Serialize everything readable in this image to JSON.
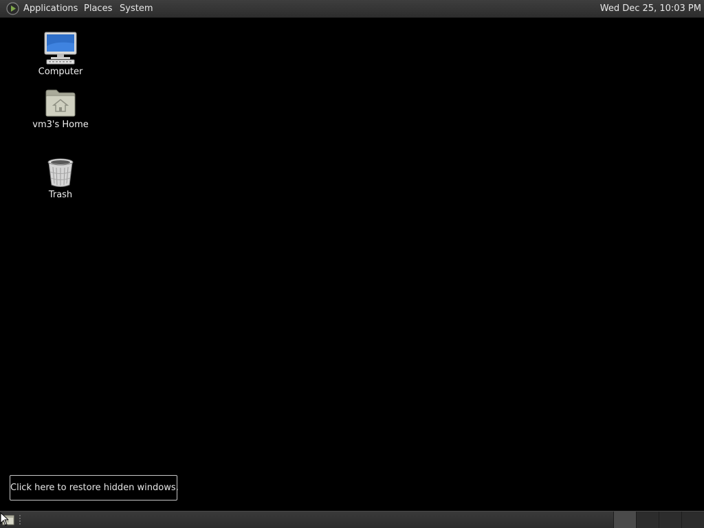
{
  "top_panel": {
    "menus": {
      "applications": "Applications",
      "places": "Places",
      "system": "System"
    },
    "clock": "Wed Dec 25, 10:03 PM",
    "logo_icon": "distro-logo-icon"
  },
  "desktop": {
    "icons": [
      {
        "label": "Computer",
        "icon": "computer-icon"
      },
      {
        "label": "vm3's Home",
        "icon": "home-folder-icon"
      },
      {
        "label": "Trash",
        "icon": "trash-icon"
      }
    ],
    "background_color": "#000000"
  },
  "restore_tooltip": {
    "text": "Click here to restore hidden windows."
  },
  "bottom_panel": {
    "show_desktop_icon": "show-desktop-icon",
    "workspaces": [
      {
        "name": "workspace-1",
        "active": true
      },
      {
        "name": "workspace-2",
        "active": false
      },
      {
        "name": "workspace-3",
        "active": false
      },
      {
        "name": "workspace-4",
        "active": false
      }
    ]
  },
  "colors": {
    "panel": "#333333",
    "text": "#e8e8e8"
  }
}
